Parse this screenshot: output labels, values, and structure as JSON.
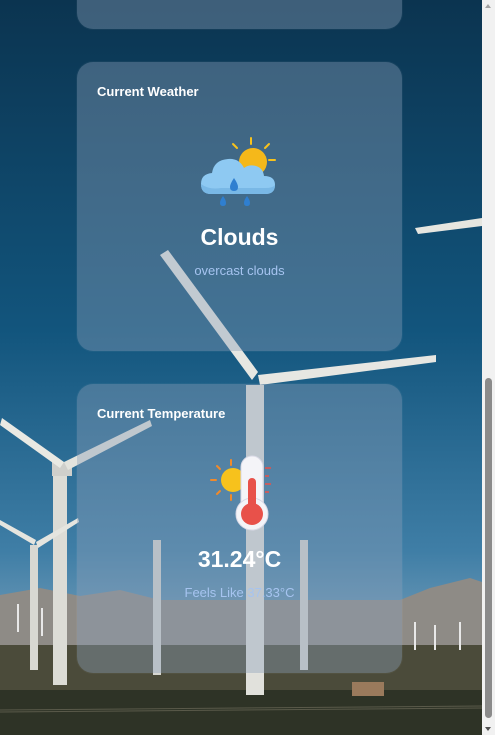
{
  "weather_card": {
    "title": "Current Weather",
    "icon": "cloud-sun-rain-icon",
    "condition": "Clouds",
    "description": "overcast clouds"
  },
  "temperature_card": {
    "title": "Current Temperature",
    "icon": "thermometer-sun-icon",
    "temperature": "31.24°C",
    "feels_like": "Feels Like 37.33°C"
  },
  "colors": {
    "card_bg": "#8ca0b9",
    "accent_text": "#a6c4f0",
    "sun": "#f7c21c",
    "thermometer_red": "#e8514a",
    "cloud": "#8ec9f2"
  }
}
